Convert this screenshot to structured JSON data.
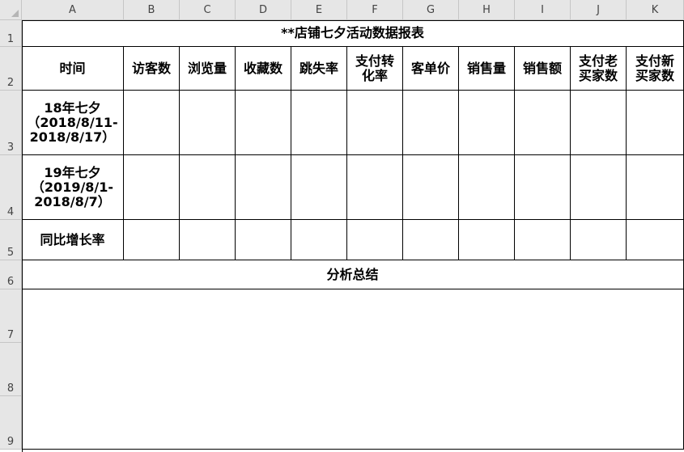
{
  "columns": [
    "A",
    "B",
    "C",
    "D",
    "E",
    "F",
    "G",
    "H",
    "I",
    "J",
    "K"
  ],
  "rows": [
    "1",
    "2",
    "3",
    "4",
    "5",
    "6",
    "7",
    "8",
    "9"
  ],
  "report": {
    "title": "**店铺七夕活动数据报表",
    "headers": [
      "时间",
      "访客数",
      "浏览量",
      "收藏数",
      "跳失率",
      "支付转\n化率",
      "客单价",
      "销售量",
      "销售额",
      "支付老\n买家数",
      "支付新\n买家数"
    ],
    "row_labels": [
      "18年七夕\n（2018/8/11-\n2018/8/17）",
      "19年七夕\n（2019/8/1-\n2018/8/7）",
      "同比增长率"
    ],
    "summary_label": "分析总结"
  }
}
